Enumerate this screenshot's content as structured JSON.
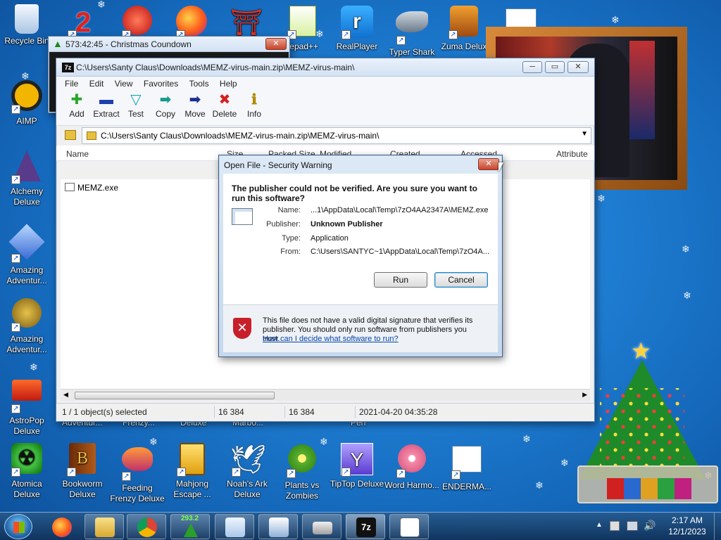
{
  "desktop": {
    "icons": [
      {
        "label": "Recycle Bin"
      },
      {
        "label": "AIMP"
      },
      {
        "label": "Alchemy Deluxe"
      },
      {
        "label": "Amazing Adventur..."
      },
      {
        "label": "Amazing Adventur..."
      },
      {
        "label": "AstroPop Deluxe"
      },
      {
        "label": "Atomica Deluxe"
      },
      {
        "label": "Bookworm Deluxe"
      },
      {
        "label": "Feeding Frenzy Deluxe"
      },
      {
        "label": "Mahjong Escape ..."
      },
      {
        "label": "Noah's Ark Deluxe"
      },
      {
        "label": "Plants vs Zombies"
      },
      {
        "label": "TipTop Deluxe"
      },
      {
        "label": "Word Harmo..."
      },
      {
        "label": "ENDERMA..."
      },
      {
        "label": "tepad++"
      },
      {
        "label": "RealPlayer"
      },
      {
        "label": "Typer Shark Delu..."
      },
      {
        "label": "Zuma Delux"
      }
    ],
    "hidden_labels": [
      "Adventur...",
      "Frenzy...",
      "Deluxe",
      "Marbo...",
      "Pen"
    ]
  },
  "countdown_window": {
    "title": "573:42:45 - Christmas Coundown"
  },
  "sevenzip": {
    "title": "C:\\Users\\Santy Claus\\Downloads\\MEMZ-virus-main.zip\\MEMZ-virus-main\\",
    "menu": [
      "File",
      "Edit",
      "View",
      "Favorites",
      "Tools",
      "Help"
    ],
    "toolbar": [
      {
        "label": "Add",
        "icon": "plus-icon",
        "glyph": "✚",
        "color": "#2aa62a"
      },
      {
        "label": "Extract",
        "icon": "minus-icon",
        "glyph": "▬",
        "color": "#1f3fae"
      },
      {
        "label": "Test",
        "icon": "check-icon",
        "glyph": "▽",
        "color": "#12a8b8"
      },
      {
        "label": "Copy",
        "icon": "copy-arrow-icon",
        "glyph": "➡",
        "color": "#199a8a"
      },
      {
        "label": "Move",
        "icon": "move-arrow-icon",
        "glyph": "➡",
        "color": "#1b2f8f"
      },
      {
        "label": "Delete",
        "icon": "delete-x-icon",
        "glyph": "✖",
        "color": "#d42020"
      },
      {
        "label": "Info",
        "icon": "info-icon",
        "glyph": "ℹ",
        "color": "#b08a00"
      }
    ],
    "address": "C:\\Users\\Santy Claus\\Downloads\\MEMZ-virus-main.zip\\MEMZ-virus-main\\",
    "columns": [
      "Name",
      "Size",
      "Packed Size",
      "Modified",
      "Created",
      "Accessed",
      "Attribute"
    ],
    "file": "MEMZ.exe",
    "status": {
      "selected": "1 / 1 object(s) selected",
      "size": "16 384",
      "packed": "16 384",
      "date": "2021-04-20 04:35:28"
    }
  },
  "dialog": {
    "title": "Open File - Security Warning",
    "question": "The publisher could not be verified.  Are you sure you want to run this software?",
    "name_label": "Name:",
    "name": "...1\\AppData\\Local\\Temp\\7zO4AA2347A\\MEMZ.exe",
    "publisher_label": "Publisher:",
    "publisher": "Unknown Publisher",
    "type_label": "Type:",
    "type": "Application",
    "from_label": "From:",
    "from": "C:\\Users\\SANTYC~1\\AppData\\Local\\Temp\\7zO4A...",
    "run_button": "Run",
    "cancel_button": "Cancel",
    "warning": "This file does not have a valid digital signature that verifies its publisher.  You should only run software from publishers you trust.",
    "help_link": "How can I decide what software to run?"
  },
  "taskbar": {
    "badge": "293.2",
    "tray_time": "2:17 AM",
    "tray_date": "12/1/2023"
  },
  "colors": {
    "desktop_blue": "#1f7fd4",
    "link": "#0645ad",
    "warning_red": "#c8202a"
  }
}
